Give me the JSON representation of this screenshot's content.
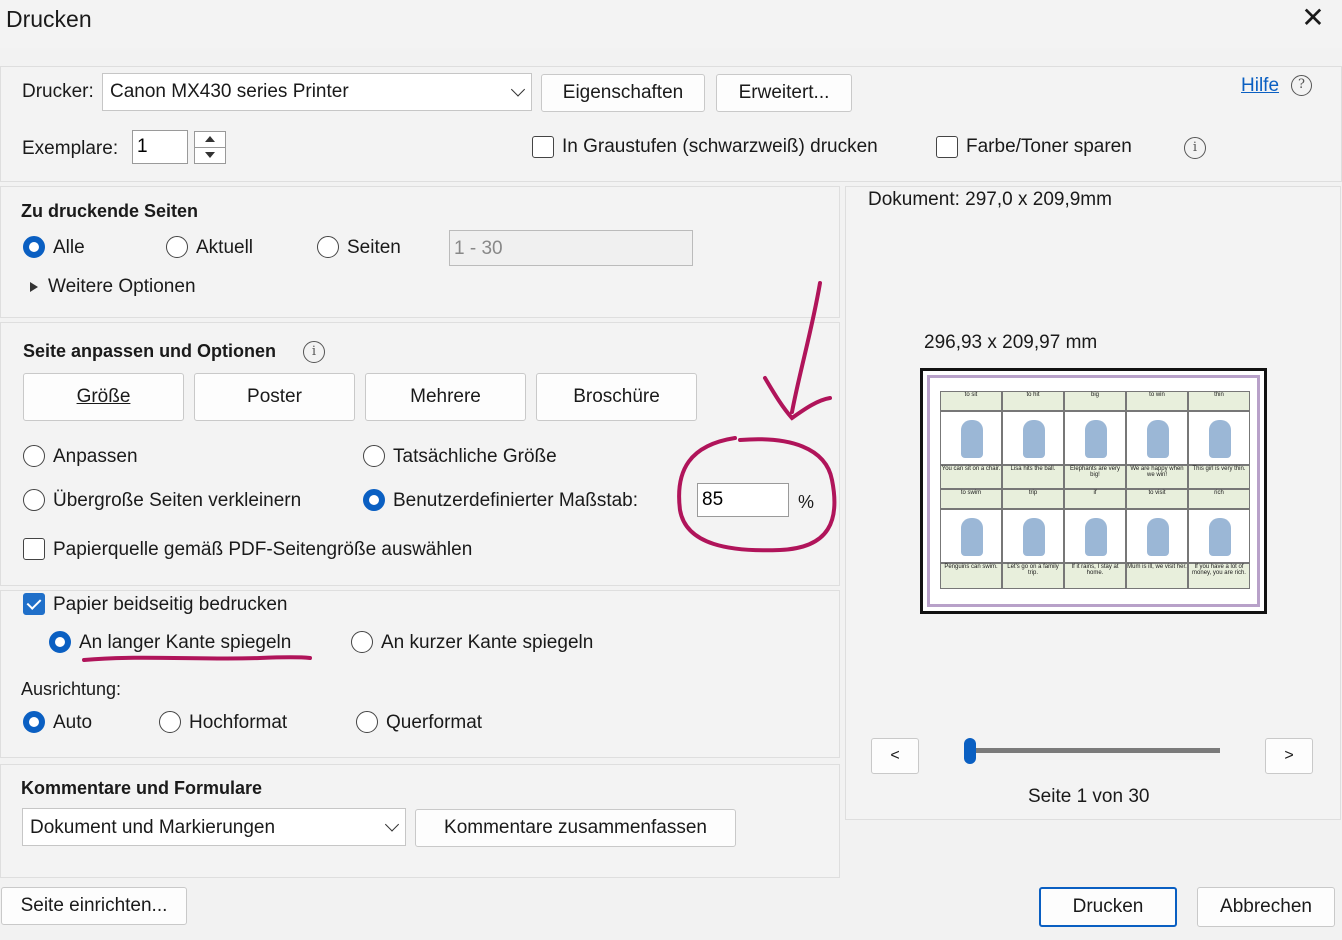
{
  "window": {
    "title": "Drucken"
  },
  "printer": {
    "label": "Drucker:",
    "selected": "Canon MX430 series Printer",
    "properties_button": "Eigenschaften",
    "advanced_button": "Erweitert...",
    "help_link": "Hilfe"
  },
  "copies": {
    "label": "Exemplare:",
    "value": "1"
  },
  "options": {
    "grayscale_label": "In Graustufen (schwarzweiß) drucken",
    "save_toner_label": "Farbe/Toner sparen"
  },
  "pages": {
    "heading": "Zu druckende Seiten",
    "all": "Alle",
    "current": "Aktuell",
    "pages": "Seiten",
    "range_placeholder": "1 - 30",
    "more_options": "Weitere Optionen"
  },
  "fit": {
    "heading": "Seite anpassen und Optionen",
    "tabs": [
      "Größe",
      "Poster",
      "Mehrere",
      "Broschüre"
    ],
    "fit": "Anpassen",
    "actual": "Tatsächliche Größe",
    "shrink": "Übergroße Seiten verkleinern",
    "custom": "Benutzerdefinierter Maßstab:",
    "scale_value": "85",
    "percent": "%",
    "paper_source": "Papierquelle gemäß PDF-Seitengröße auswählen"
  },
  "duplex": {
    "label": "Papier beidseitig bedrucken",
    "long_edge": "An langer Kante spiegeln",
    "short_edge": "An kurzer Kante spiegeln"
  },
  "orientation": {
    "label": "Ausrichtung:",
    "auto": "Auto",
    "portrait": "Hochformat",
    "landscape": "Querformat"
  },
  "comments": {
    "heading": "Kommentare und Formulare",
    "selected": "Dokument und Markierungen",
    "summarize_button": "Kommentare zusammenfassen"
  },
  "preview": {
    "document_size": "Dokument: 297,0 x 209,9mm",
    "page_size": "296,93 x 209,97 mm",
    "prev": "<",
    "next": ">",
    "page_indicator": "Seite 1 von 30",
    "page_position": 0.0,
    "words_top": [
      "to sit",
      "to hit",
      "big",
      "to win",
      "thin"
    ],
    "sent_top": [
      "You can sit on a chair.",
      "Lisa hits the ball.",
      "Elephants are very big!",
      "We are happy when we win!",
      "This girl is very thin."
    ],
    "words_bottom": [
      "to swim",
      "trip",
      "if",
      "to visit",
      "rich"
    ],
    "sent_bottom": [
      "Penguins can swim.",
      "Let's go on a family trip.",
      "If it rains, I stay at home.",
      "Mum is ill, we visit her.",
      "If you have a lot of money, you are rich."
    ]
  },
  "footer": {
    "page_setup": "Seite einrichten...",
    "print": "Drucken",
    "cancel": "Abbrechen"
  },
  "colors": {
    "accent": "#0a5fc2",
    "annotation": "#b0145a"
  }
}
